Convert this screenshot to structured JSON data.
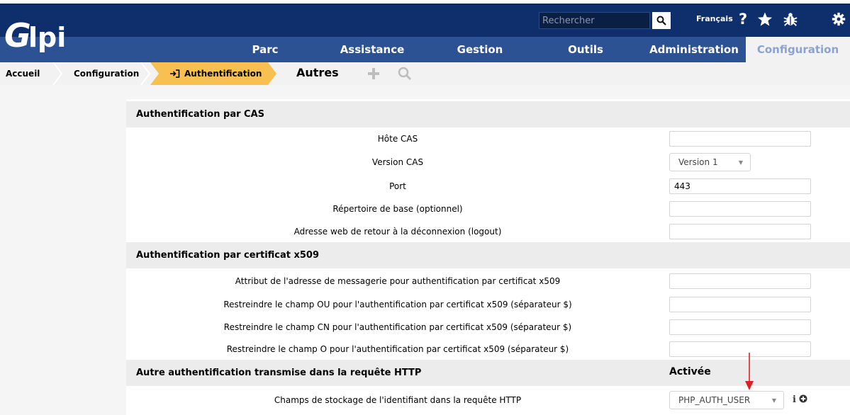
{
  "header": {
    "search_placeholder": "Rechercher",
    "language": "Français",
    "icons": [
      "help-icon",
      "star-icon",
      "bug-icon",
      "gear-icon"
    ]
  },
  "menu": {
    "items": [
      "Parc",
      "Assistance",
      "Gestion",
      "Outils",
      "Administration",
      "Configuration"
    ],
    "active": "Configuration"
  },
  "breadcrumb": {
    "items": [
      "Accueil",
      "Configuration",
      "Authentification"
    ],
    "page_title": "Autres"
  },
  "sections": {
    "cas": {
      "title": "Authentification par CAS",
      "host_label": "Hôte CAS",
      "host_value": "",
      "version_label": "Version CAS",
      "version_value": "Version 1",
      "port_label": "Port",
      "port_value": "443",
      "basedir_label": "Répertoire de base (optionnel)",
      "basedir_value": "",
      "logout_label": "Adresse web de retour à la déconnexion (logout)",
      "logout_value": ""
    },
    "x509": {
      "title": "Authentification par certificat x509",
      "email_label": "Attribut de l'adresse de messagerie pour authentification par certificat x509",
      "ou_label": "Restreindre le champ OU pour l'authentification par certificat x509 (séparateur $)",
      "cn_label": "Restreindre le champ CN pour l'authentification par certificat x509 (séparateur $)",
      "o_label": "Restreindre le champ O pour l'authentification par certificat x509 (séparateur $)"
    },
    "http": {
      "title": "Autre authentification transmise dans la requête HTTP",
      "enabled_label": "Activée",
      "field_label": "Champs de stockage de l'identifiant dans la requête HTTP",
      "field_value": "PHP_AUTH_USER"
    }
  },
  "colors": {
    "header_dark": "#0e2f6b",
    "menu_blue": "#2c5294",
    "breadcrumb_active": "#f8c050",
    "annotation_arrow": "#e02020"
  }
}
